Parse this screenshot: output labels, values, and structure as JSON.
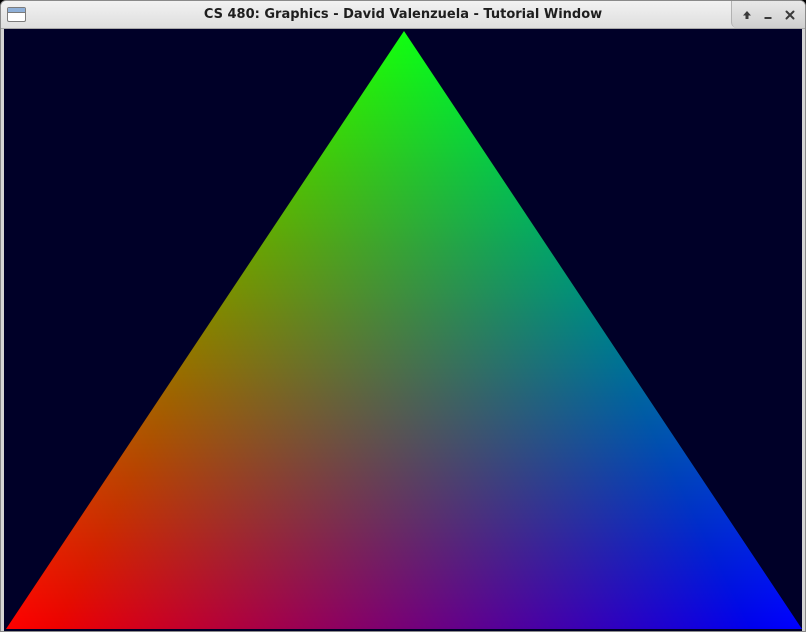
{
  "window": {
    "title": "CS 480: Graphics - David Valenzuela - Tutorial Window",
    "icons": {
      "app": "window-icon",
      "maximize": "maximize-arrow-icon",
      "minimize": "minimize-icon",
      "close": "close-icon"
    }
  },
  "scene": {
    "background_color": "#000028",
    "vertex_colors": {
      "top": "#00ff00",
      "bottom_left": "#ff0000",
      "bottom_right": "#0000ff"
    }
  }
}
